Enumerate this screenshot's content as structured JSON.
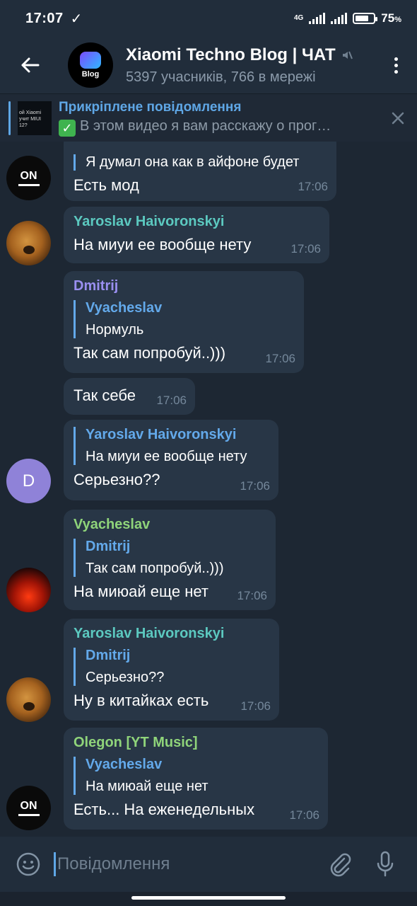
{
  "status_bar": {
    "time": "17:07",
    "network": "4G",
    "battery": "75",
    "battery_unit": "%",
    "battery_level": 0.75
  },
  "header": {
    "title": "Xiaomi Techno Blog | ЧАТ",
    "subtitle": "5397 учасників, 766 в мережі",
    "avatar_text": "Blog"
  },
  "pinned": {
    "title": "Прикріплене повідомлення",
    "message": "В этом видео я вам расскажу о прог…",
    "thumb_text": "ой Xiaomi учит MIUI 12?"
  },
  "messages": [
    {
      "reply_text": "Я думал она как в айфоне будет",
      "text": "Есть мод",
      "time": "17:06",
      "avatar": "ON"
    },
    {
      "sender": "Yaroslav Haivoronskyi",
      "text": "На миуи ее вообще нету",
      "time": "17:06"
    },
    {
      "sender": "Dmitrij",
      "reply_name": "Vyacheslav",
      "reply_text": "Нормуль",
      "text": "Так сам попробуй..)))",
      "time": "17:06"
    },
    {
      "text": "Так себе",
      "time": "17:06",
      "avatar": "D"
    },
    {
      "reply_name": "Yaroslav Haivoronskyi",
      "reply_text": "На миуи ее вообще нету",
      "text": "Серьезно??",
      "time": "17:06"
    },
    {
      "sender": "Vyacheslav",
      "reply_name": "Dmitrij",
      "reply_text": "Так сам попробуй..)))",
      "text": "На миюай еще нет",
      "time": "17:06"
    },
    {
      "sender": "Yaroslav Haivoronskyi",
      "reply_name": "Dmitrij",
      "reply_text": "Серьезно??",
      "text": "Ну в китайках есть",
      "time": "17:06"
    },
    {
      "sender": "Olegon [YT Music]",
      "reply_name": "Vyacheslav",
      "reply_text": "На миюай еще нет",
      "text": "Есть... На еженедельных",
      "time": "17:06",
      "avatar": "ON"
    }
  ],
  "composer": {
    "placeholder": "Повідомлення"
  },
  "colors": {
    "background": "#1d2733",
    "bar": "#212d3b",
    "bubble": "#283646",
    "accent": "#5fa7e6",
    "sender_teal": "#5cc9c0",
    "sender_purple": "#9a8ff0",
    "sender_green": "#8fd47a"
  }
}
